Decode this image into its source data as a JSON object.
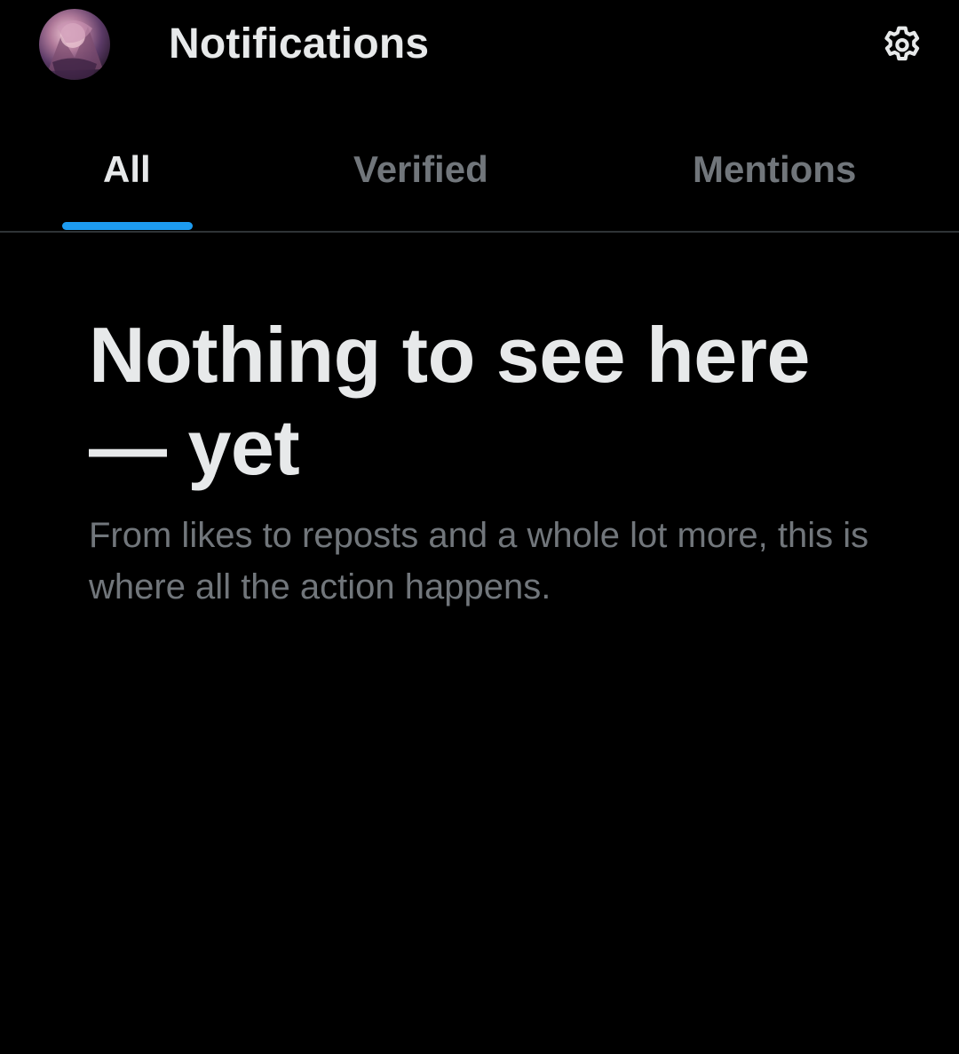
{
  "header": {
    "title": "Notifications",
    "avatar_icon": "profile-avatar",
    "settings_icon": "gear-icon"
  },
  "tabs": [
    {
      "label": "All",
      "selected": true
    },
    {
      "label": "Verified",
      "selected": false
    },
    {
      "label": "Mentions",
      "selected": false
    }
  ],
  "empty_state": {
    "title": "Nothing to see here — yet",
    "body": "From likes to reposts and a whole lot more, this is where all the action happens."
  },
  "colors": {
    "background": "#000000",
    "accent": "#1d9bf0",
    "primary_text": "#e7e9ea",
    "secondary_text": "#71767b",
    "divider": "#2f3336"
  }
}
